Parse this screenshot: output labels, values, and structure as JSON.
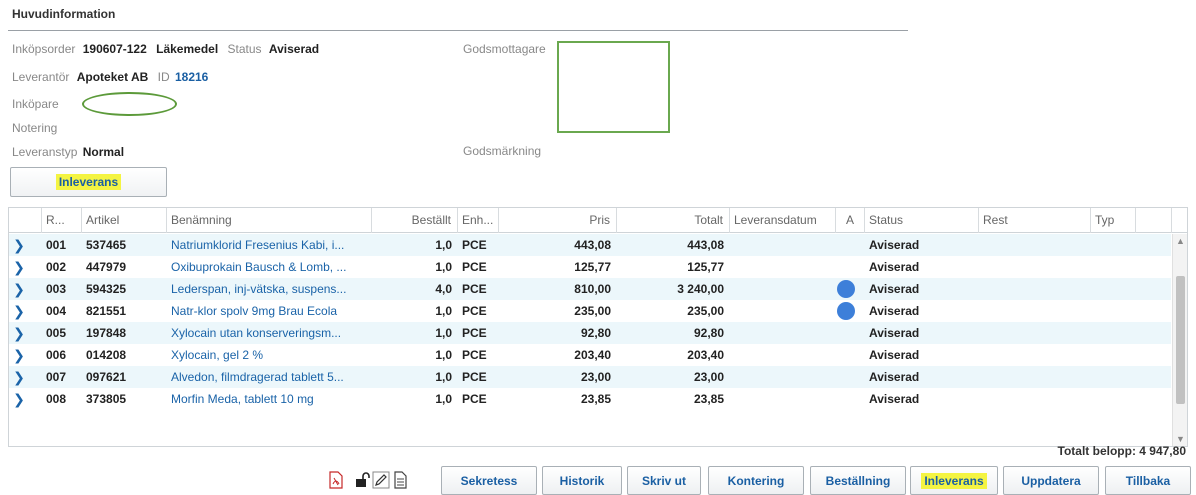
{
  "header": {
    "title": "Huvudinformation"
  },
  "order": {
    "inkopsorder_label": "Inköpsorder",
    "inkopsorder_value": "190607-122",
    "category": "Läkemedel",
    "status_label": "Status",
    "status_value": "Aviserad",
    "leverantor_label": "Leverantör",
    "leverantor_value": "Apoteket AB",
    "id_label": "ID",
    "id_value": "18216",
    "inkopare_label": "Inköpare",
    "notering_label": "Notering",
    "leveranstyp_label": "Leveranstyp",
    "leveranstyp_value": "Normal",
    "godsmottagare_label": "Godsmottagare",
    "godsmarkning_label": "Godsmärkning"
  },
  "top_button": {
    "label": "Inleverans"
  },
  "table": {
    "columns": [
      "R...",
      "Artikel",
      "Benämning",
      "Beställt",
      "Enh...",
      "Pris",
      "Totalt",
      "Leveransdatum",
      "A",
      "Status",
      "Rest",
      "Typ"
    ],
    "rows": [
      {
        "r": "001",
        "artikel": "537465",
        "benamning": "Natriumklorid Fresenius Kabi, i...",
        "bestallt": "1,0",
        "enh": "PCE",
        "pris": "443,08",
        "totalt": "443,08",
        "a": false,
        "status": "Aviserad"
      },
      {
        "r": "002",
        "artikel": "447979",
        "benamning": "Oxibuprokain Bausch & Lomb, ...",
        "bestallt": "1,0",
        "enh": "PCE",
        "pris": "125,77",
        "totalt": "125,77",
        "a": false,
        "status": "Aviserad"
      },
      {
        "r": "003",
        "artikel": "594325",
        "benamning": "Lederspan, inj-vätska, suspens...",
        "bestallt": "4,0",
        "enh": "PCE",
        "pris": "810,00",
        "totalt": "3 240,00",
        "a": true,
        "status": "Aviserad"
      },
      {
        "r": "004",
        "artikel": "821551",
        "benamning": "Natr-klor spolv 9mg Brau Ecola",
        "bestallt": "1,0",
        "enh": "PCE",
        "pris": "235,00",
        "totalt": "235,00",
        "a": true,
        "status": "Aviserad"
      },
      {
        "r": "005",
        "artikel": "197848",
        "benamning": "Xylocain utan konserveringsm...",
        "bestallt": "1,0",
        "enh": "PCE",
        "pris": "92,80",
        "totalt": "92,80",
        "a": false,
        "status": "Aviserad"
      },
      {
        "r": "006",
        "artikel": "014208",
        "benamning": "Xylocain, gel 2 %",
        "bestallt": "1,0",
        "enh": "PCE",
        "pris": "203,40",
        "totalt": "203,40",
        "a": false,
        "status": "Aviserad"
      },
      {
        "r": "007",
        "artikel": "097621",
        "benamning": "Alvedon, filmdragerad tablett 5...",
        "bestallt": "1,0",
        "enh": "PCE",
        "pris": "23,00",
        "totalt": "23,00",
        "a": false,
        "status": "Aviserad"
      },
      {
        "r": "008",
        "artikel": "373805",
        "benamning": "Morfin Meda, tablett 10 mg",
        "bestallt": "1,0",
        "enh": "PCE",
        "pris": "23,85",
        "totalt": "23,85",
        "a": false,
        "status": "Aviserad"
      }
    ]
  },
  "totals": {
    "label": "Totalt belopp: 4 947,80"
  },
  "toolbar": {
    "icons": [
      "pdf-icon",
      "unlock-icon",
      "pencil-icon",
      "document-icon"
    ],
    "buttons": [
      "Sekretess",
      "Historik",
      "Skriv ut",
      "Kontering",
      "Beställning",
      "Inleverans",
      "Uppdatera",
      "Tillbaka"
    ],
    "highlighted_button": "Inleverans"
  },
  "colors": {
    "link": "#1a63a8",
    "row_alt": "#ecf7fb",
    "highlight": "#f4f442",
    "status_dot": "#3d7fd9",
    "annotation_green": "#6aa84f"
  }
}
